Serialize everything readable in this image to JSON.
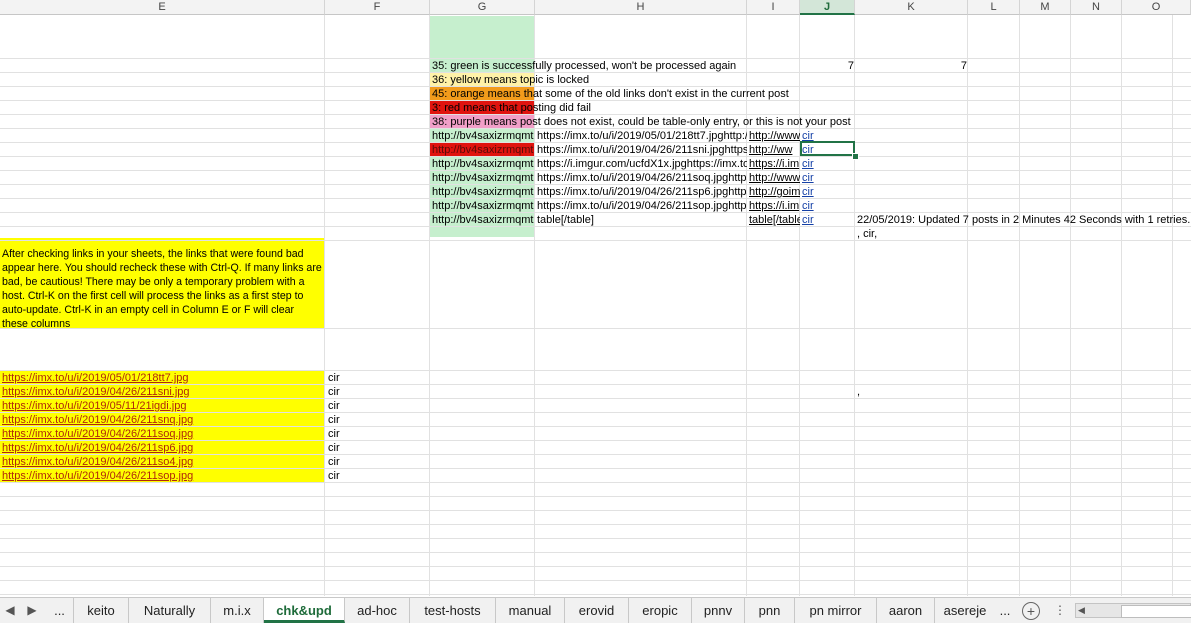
{
  "columns": [
    "E",
    "F",
    "G",
    "H",
    "I",
    "J",
    "K",
    "L",
    "M",
    "N",
    "O"
  ],
  "selected_column": "J",
  "legend": {
    "green": "35: green is successfully processed, won't be processed again",
    "yellow": "36: yellow means topic is locked",
    "orange": "45: orange means that some of the old links don't exist in the current post",
    "red": "3: red means that posting did fail",
    "purple": "38: purple means post does not exist, could be table-only entry, or this is not your post"
  },
  "counts": {
    "j": "7",
    "k": "7"
  },
  "rows": [
    {
      "g": "http://bv4saxizrmqmt",
      "h": "https://imx.to/u/i/2019/05/01/218tt7.jpghttp://",
      "i": "http://www",
      "j": "cir"
    },
    {
      "g": "http://bv4saxizrmqmt",
      "h": "https://imx.to/u/i/2019/04/26/211sni.jpghttps:",
      "i": "http://ww",
      "j": "cir"
    },
    {
      "g": "http://bv4saxizrmqmt",
      "h": "https://i.imgur.com/ucfdX1x.jpghttps://imx.to",
      "i": "https://i.im",
      "j": "cir"
    },
    {
      "g": "http://bv4saxizrmqmt",
      "h": "https://imx.to/u/i/2019/04/26/211soq.jpghttps",
      "i": "http://www",
      "j": "cir"
    },
    {
      "g": "http://bv4saxizrmqmt",
      "h": "https://imx.to/u/i/2019/04/26/211sp6.jpghttps",
      "i": "http://goim",
      "j": "cir"
    },
    {
      "g": "http://bv4saxizrmqmt",
      "h": "https://imx.to/u/i/2019/04/26/211sop.jpghttp:",
      "i": "https://i.im",
      "j": "cir"
    },
    {
      "g": "http://bv4saxizrmqmt",
      "h": "table[/table]",
      "i": "table[/table",
      "j": "cir"
    }
  ],
  "status_message": "22/05/2019: Updated 7 posts in 2 Minutes 42 Seconds with 1 retries.",
  "status_sub": ", cir,",
  "stray_comma": ",",
  "note": "After checking links in your sheets, the links that were found bad appear here. You should recheck these with Ctrl-Q. If many links are bad, be cautious! There may be only a temporary problem with a host. Ctrl-K on the first cell will process the links as a first step to auto-update. Ctrl-K in an empty cell in Column E or F will clear these columns",
  "bad_links": [
    {
      "url": "https://imx.to/u/i/2019/05/01/218tt7.jpg",
      "tag": "cir"
    },
    {
      "url": "https://imx.to/u/i/2019/04/26/211sni.jpg",
      "tag": "cir"
    },
    {
      "url": "https://imx.to/u/i/2019/05/11/21igdi.jpg",
      "tag": "cir"
    },
    {
      "url": "https://imx.to/u/i/2019/04/26/211snq.jpg",
      "tag": "cir"
    },
    {
      "url": "https://imx.to/u/i/2019/04/26/211soq.jpg",
      "tag": "cir"
    },
    {
      "url": "https://imx.to/u/i/2019/04/26/211sp6.jpg",
      "tag": "cir"
    },
    {
      "url": "https://imx.to/u/i/2019/04/26/211so4.jpg",
      "tag": "cir"
    },
    {
      "url": "https://imx.to/u/i/2019/04/26/211sop.jpg",
      "tag": "cir"
    }
  ],
  "tabs": [
    "...",
    "keito",
    "Naturally",
    "m.i.x",
    "chk&upd",
    "ad-hoc",
    "test-hosts",
    "manual",
    "erovid",
    "eropic",
    "pnnv",
    "pnn",
    "pn mirror",
    "aaron",
    "asereje",
    "..."
  ],
  "active_tab": "chk&upd",
  "colors": {
    "green": "#c6efce",
    "yellow": "#ffff00",
    "light_yellow": "#fff2a8",
    "orange": "#f29b1b",
    "red": "#e0140f",
    "purple": "#f19fc8",
    "accent": "#217346"
  }
}
